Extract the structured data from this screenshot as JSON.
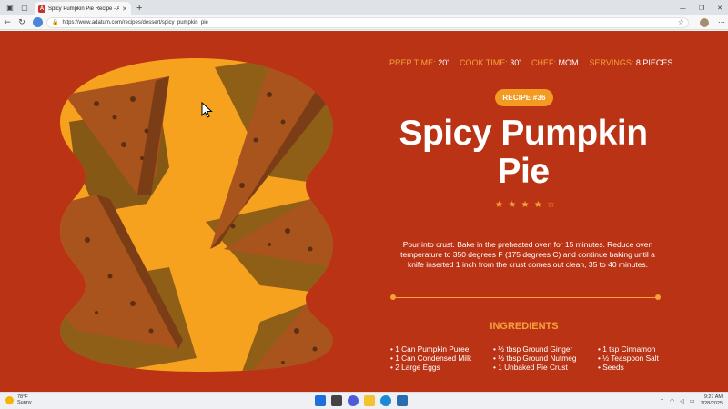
{
  "browser": {
    "tab_title": "Spicy Pumpkin Pie Recipe - Adatum",
    "tab_favicon": "A",
    "url": "https://www.adatum.com/recipes/dessert/spicy_pumpkin_pie"
  },
  "recipe": {
    "meta": [
      {
        "label": "PREP TIME:",
        "value": "20'"
      },
      {
        "label": "COOK TIME:",
        "value": "30'"
      },
      {
        "label": "CHEF:",
        "value": "MOM"
      },
      {
        "label": "SERVINGS:",
        "value": "8 PIECES"
      }
    ],
    "badge": "RECIPE #36",
    "title": "Spicy Pumpkin Pie",
    "rating": {
      "stars": 4,
      "max": 5
    },
    "description": "Pour into crust. Bake in the preheated oven for 15 minutes. Reduce oven temperature to 350 degrees F (175 degrees C) and continue baking until a knife inserted 1 inch from the crust comes out clean, 35 to 40 minutes.",
    "ingredients_title": "INGREDIENTS",
    "ingredients": [
      [
        "• 1 Can Pumpkin Puree",
        "• 1 Can Condensed Milk",
        "• 2 Large Eggs"
      ],
      [
        "• ½ tbsp Ground Ginger",
        "• ½ tbsp Ground Nutmeg",
        "• 1 Unbaked Pie Crust"
      ],
      [
        "• 1 tsp Cinnamon",
        "• ½ Teaspoon Salt",
        "• Seeds"
      ]
    ],
    "colors": {
      "background": "#ba3315",
      "accent": "#f6a23a",
      "badge": "#f39a23",
      "photo_bg": "#f6a21e"
    }
  },
  "taskbar": {
    "weather_temp": "78°F",
    "weather_desc": "Sunny",
    "time": "9:27 AM",
    "date": "7/28/2025"
  }
}
